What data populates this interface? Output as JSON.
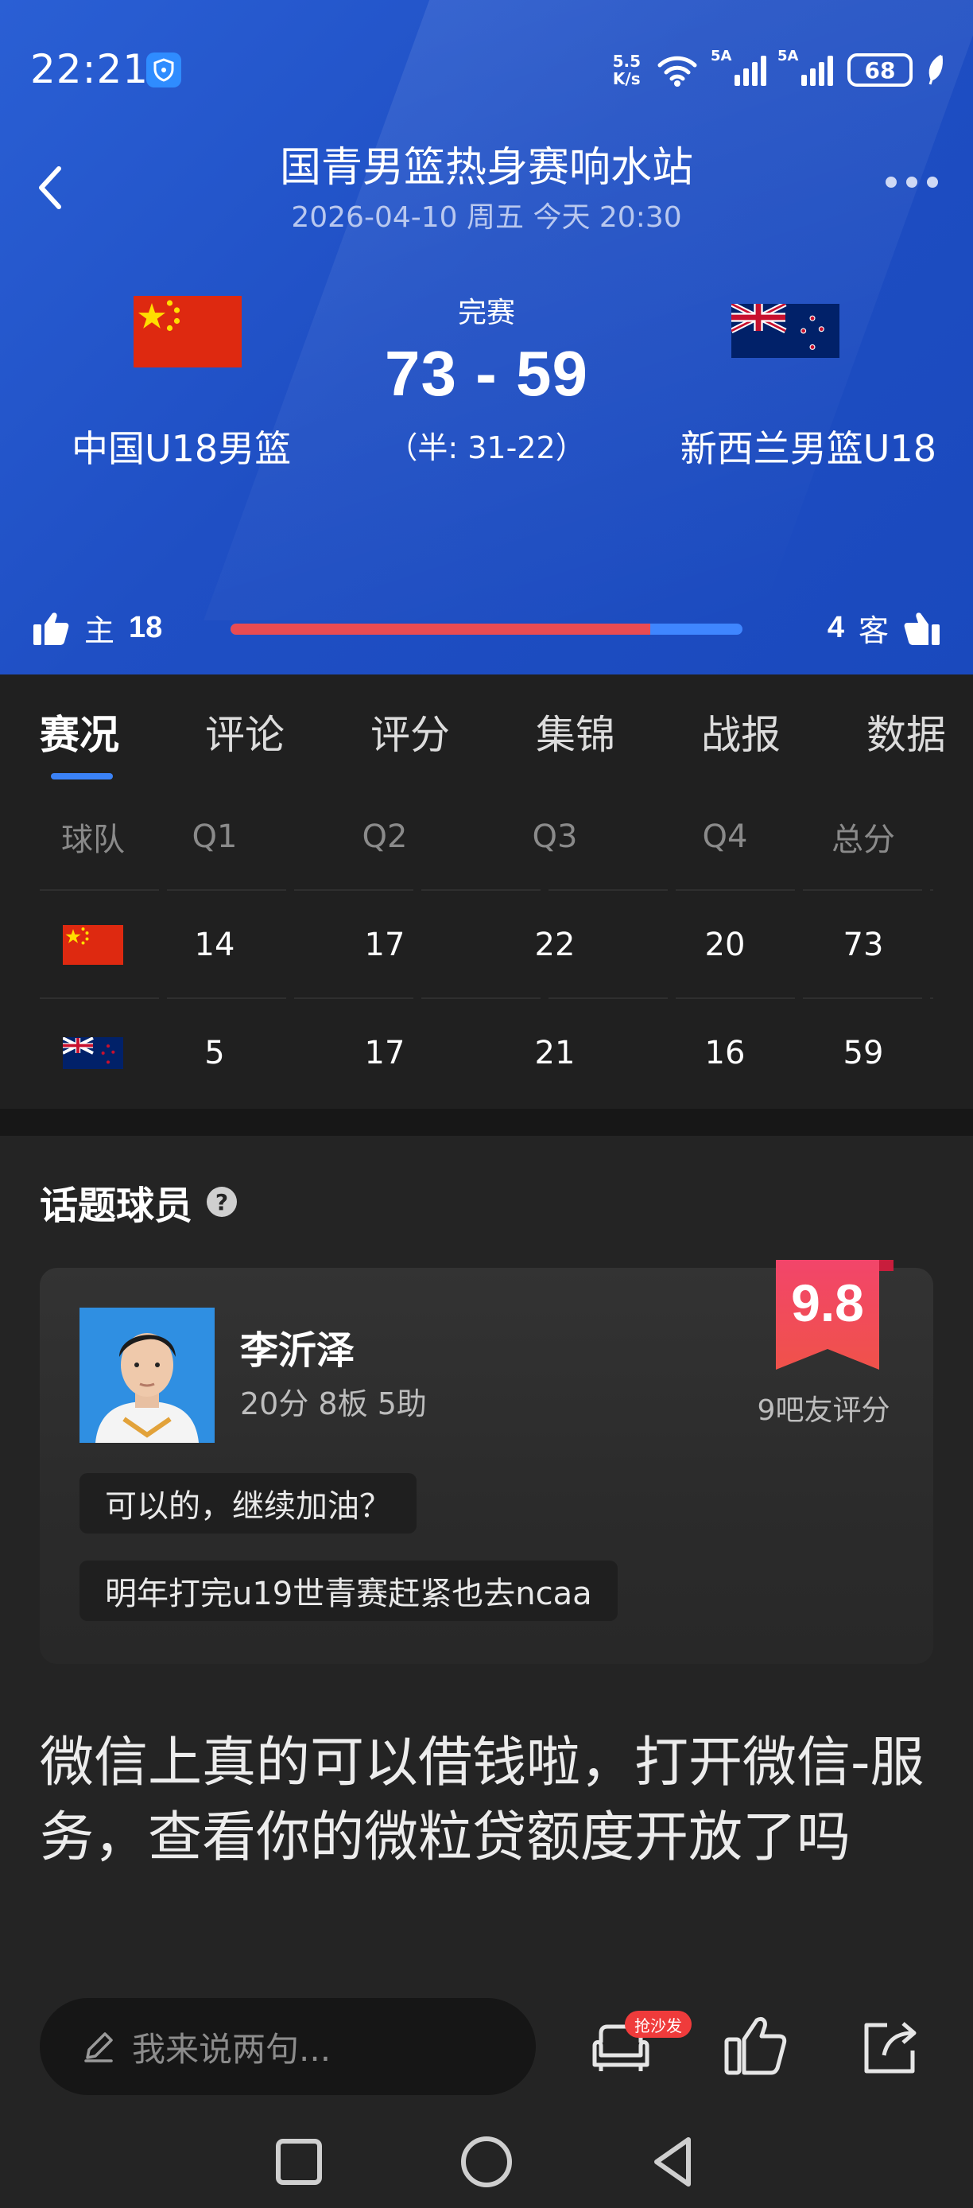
{
  "status_bar": {
    "time": "22:21",
    "net_speed_value": "5.5",
    "net_speed_unit": "K/s",
    "sim1": "5A",
    "sim2": "5A",
    "battery": "68"
  },
  "header": {
    "title": "国青男篮热身赛响水站",
    "subtitle": "2026-04-10 周五 今天 20:30"
  },
  "match": {
    "status": "完赛",
    "score": "73 - 59",
    "half_score": "（半: 31-22）",
    "home_team": "中国U18男篮",
    "away_team": "新西兰男篮U18"
  },
  "vote": {
    "home_label": "主",
    "home_count": "18",
    "away_label": "客",
    "away_count": "4",
    "home_share": 0.82
  },
  "tabs": [
    "赛况",
    "评论",
    "评分",
    "集锦",
    "战报",
    "数据"
  ],
  "scoreboard": {
    "headers": [
      "球队",
      "Q1",
      "Q2",
      "Q3",
      "Q4",
      "总分"
    ],
    "rows": [
      {
        "team": "china-flag",
        "q1": "14",
        "q2": "17",
        "q3": "22",
        "q4": "20",
        "total": "73"
      },
      {
        "team": "new-zealand-flag",
        "q1": "5",
        "q2": "17",
        "q3": "21",
        "q4": "16",
        "total": "59"
      }
    ]
  },
  "topic_player": {
    "section_title": "话题球员",
    "name": "李沂泽",
    "stats": "20分 8板 5助",
    "rating": "9.8",
    "rating_label": "9吧友评分",
    "comments": [
      "可以的，继续加油？",
      "明年打完u19世青赛赶紧也去ncaa"
    ]
  },
  "promo_text": "微信上真的可以借钱啦，打开微信-服务，查看你的微粒贷额度开放了吗",
  "bottom_bar": {
    "placeholder": "我来说两句...",
    "sofa_badge": "抢沙发"
  },
  "colors": {
    "header_blue": "#1f4fc4",
    "vote_red": "#e84b52",
    "vote_blue": "#3f86ff",
    "tab_indicator": "#3b82f6",
    "rating_badge": "#ef3b55"
  }
}
